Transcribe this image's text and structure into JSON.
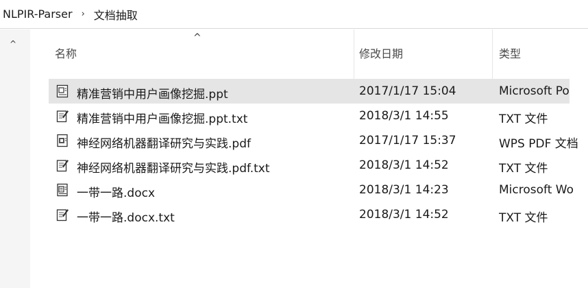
{
  "breadcrumb": {
    "root": "NLPIR-Parser",
    "separator": "›",
    "current": "文档抽取"
  },
  "nav": {
    "scroll_up_glyph": "^"
  },
  "columns": {
    "sort_glyph": "^",
    "name": "名称",
    "date": "修改日期",
    "type": "类型"
  },
  "files": [
    {
      "name": "精准营销中用户画像挖掘.ppt",
      "date": "2017/1/17 15:04",
      "type": "Microsoft Po",
      "icon": "ppt-file-icon",
      "selected": true
    },
    {
      "name": "精准营销中用户画像挖掘.ppt.txt",
      "date": "2018/3/1 14:55",
      "type": "TXT 文件",
      "icon": "txt-file-icon",
      "selected": false
    },
    {
      "name": "神经网络机器翻译研究与实践.pdf",
      "date": "2017/1/17 15:37",
      "type": "WPS PDF 文档",
      "icon": "pdf-file-icon",
      "selected": false
    },
    {
      "name": "神经网络机器翻译研究与实践.pdf.txt",
      "date": "2018/3/1 14:52",
      "type": "TXT 文件",
      "icon": "txt-file-icon",
      "selected": false
    },
    {
      "name": "一带一路.docx",
      "date": "2018/3/1 14:23",
      "type": "Microsoft Wo",
      "icon": "docx-file-icon",
      "selected": false
    },
    {
      "name": "一带一路.docx.txt",
      "date": "2018/3/1 14:52",
      "type": "TXT 文件",
      "icon": "txt-file-icon",
      "selected": false
    }
  ],
  "colors": {
    "selected_row": "#e5e5e5",
    "nav_strip": "#f5f5f5"
  }
}
